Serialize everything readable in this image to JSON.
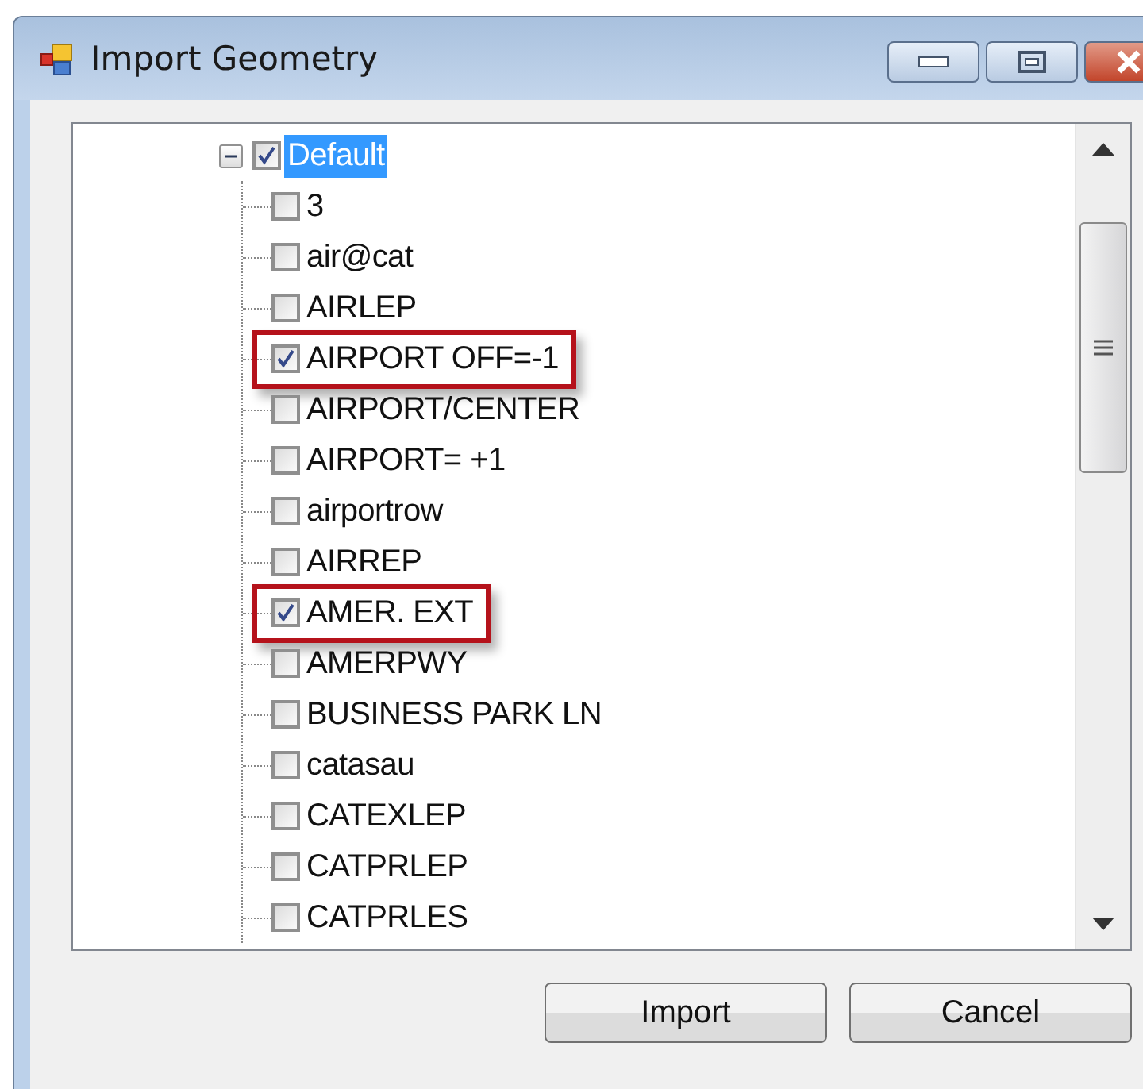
{
  "window": {
    "title": "Import Geometry"
  },
  "tree": {
    "root": {
      "label": "Default",
      "checked": true,
      "selected": true,
      "expanded": true,
      "children": [
        {
          "label": "3",
          "checked": false,
          "highlighted": false
        },
        {
          "label": "air@cat",
          "checked": false,
          "highlighted": false
        },
        {
          "label": "AIRLEP",
          "checked": false,
          "highlighted": false
        },
        {
          "label": "AIRPORT OFF=-1",
          "checked": true,
          "highlighted": true
        },
        {
          "label": "AIRPORT/CENTER",
          "checked": false,
          "highlighted": false
        },
        {
          "label": "AIRPORT= +1",
          "checked": false,
          "highlighted": false
        },
        {
          "label": "airportrow",
          "checked": false,
          "highlighted": false
        },
        {
          "label": "AIRREP",
          "checked": false,
          "highlighted": false
        },
        {
          "label": "AMER. EXT",
          "checked": true,
          "highlighted": true
        },
        {
          "label": "AMERPWY",
          "checked": false,
          "highlighted": false
        },
        {
          "label": "BUSINESS PARK LN",
          "checked": false,
          "highlighted": false
        },
        {
          "label": "catasau",
          "checked": false,
          "highlighted": false
        },
        {
          "label": "CATEXLEP",
          "checked": false,
          "highlighted": false
        },
        {
          "label": "CATPRLEP",
          "checked": false,
          "highlighted": false
        },
        {
          "label": "CATPRLES",
          "checked": false,
          "highlighted": false
        }
      ]
    }
  },
  "buttons": [
    {
      "label": "Import"
    },
    {
      "label": "Cancel"
    }
  ]
}
